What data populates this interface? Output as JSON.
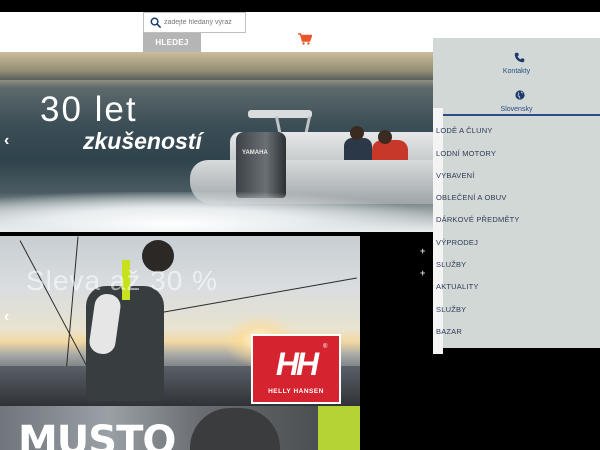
{
  "header": {
    "search": {
      "placeholder": "zadejte hledaný výraz",
      "button_label": "HLEDEJ"
    },
    "cart_icon": "cart-icon"
  },
  "hero": {
    "title": "30 let",
    "subtitle": "zkušeností",
    "arrow": "‹",
    "boat_brand": "YAMAHA"
  },
  "promo": {
    "text": "Sleva až 30 %",
    "arrow": "‹",
    "brand_mark": "HH",
    "brand_name": "HELLY HANSEN",
    "brand_reg": "®",
    "brand_color": "#d5242f"
  },
  "promo2": {
    "brand_text": "MUSTO"
  },
  "side_panel": {
    "contact_label": "Kontakty",
    "language_label": "Slovensky",
    "accent": "#2a4d88"
  },
  "menu": {
    "items": [
      {
        "label": "LODĚ A ČLUNY"
      },
      {
        "label": "LODNÍ MOTORY"
      },
      {
        "label": "VYBAVENÍ"
      },
      {
        "label": "OBLEČENÍ A OBUV"
      },
      {
        "label": "DÁRKOVÉ PŘEDMĚTY"
      },
      {
        "label": "VÝPRODEJ"
      },
      {
        "label": "SLUŽBY"
      },
      {
        "label": "AKTUALITY"
      },
      {
        "label": "SLUŽBY"
      },
      {
        "label": "BAZAR"
      }
    ],
    "expand_icon": "+"
  }
}
